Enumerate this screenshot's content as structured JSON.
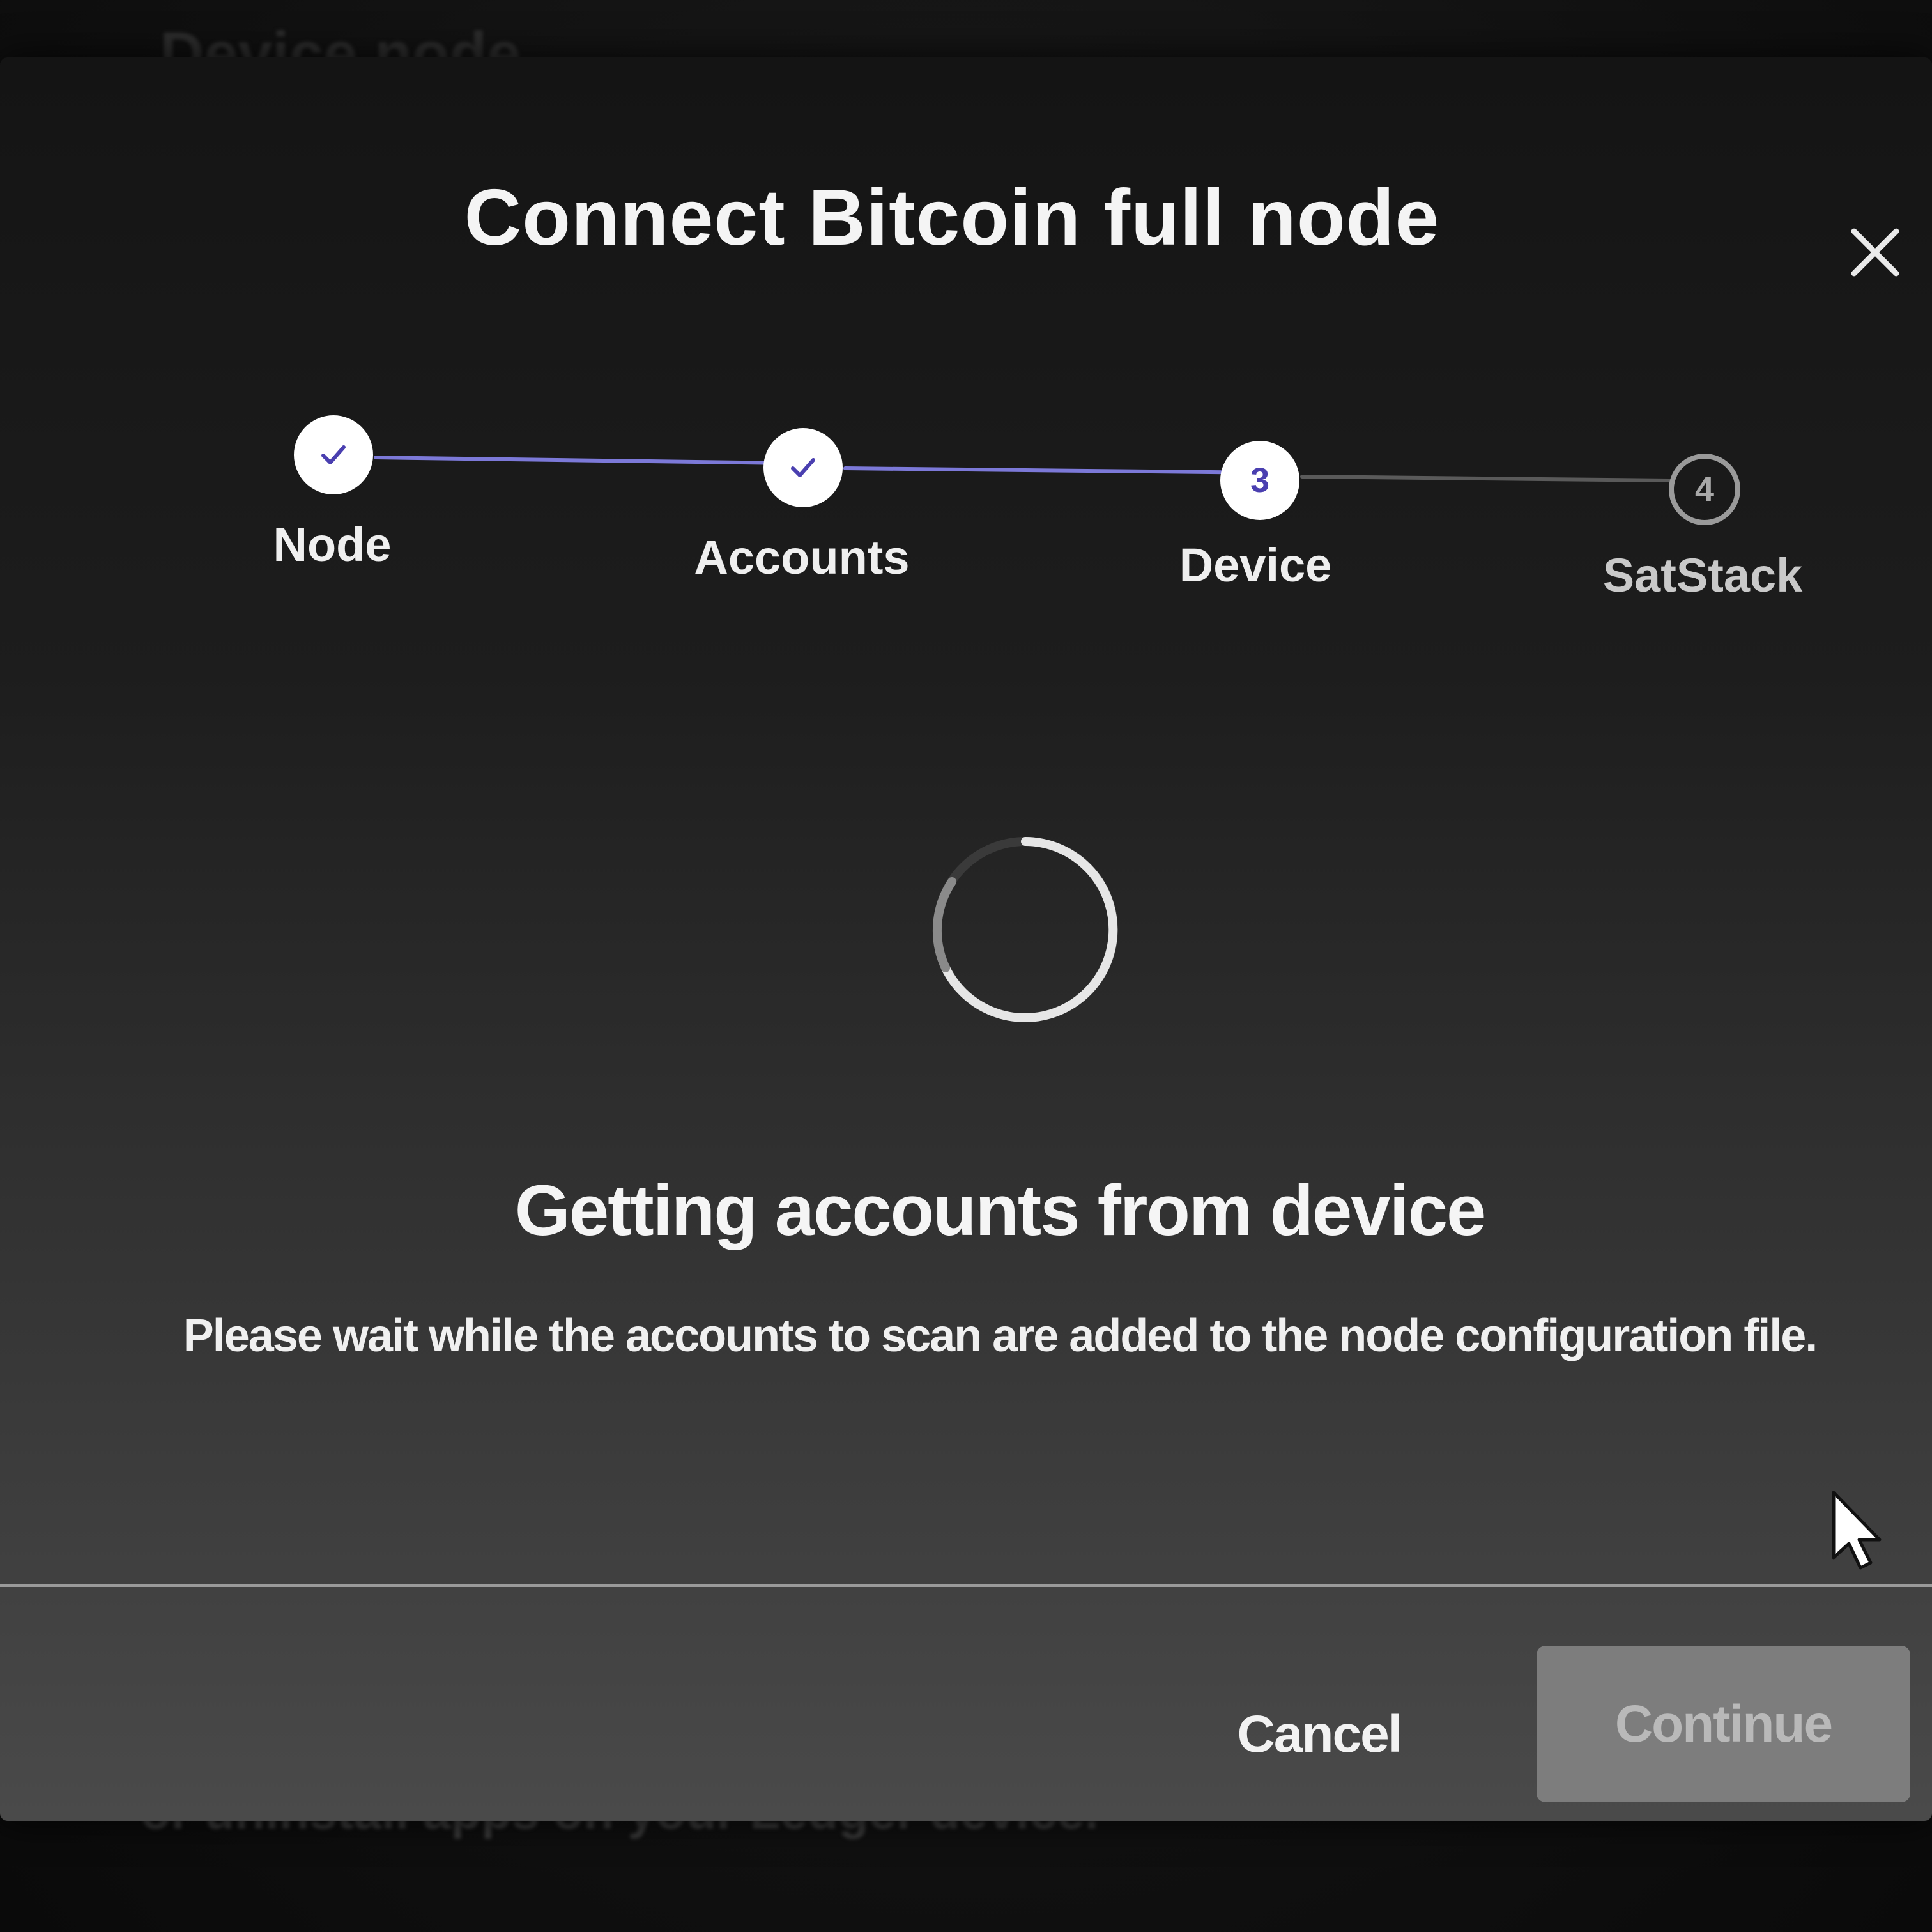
{
  "background": {
    "heading": "Device node",
    "text": "or uninstall apps on your Ledger device."
  },
  "modal": {
    "title": "Connect Bitcoin full node",
    "close_icon": "close-icon"
  },
  "stepper": {
    "steps": [
      {
        "label": "Node",
        "state": "done",
        "marker": "✓"
      },
      {
        "label": "Accounts",
        "state": "done",
        "marker": "✓"
      },
      {
        "label": "Device",
        "state": "active",
        "marker": "3"
      },
      {
        "label": "SatStack",
        "state": "todo",
        "marker": "4"
      }
    ],
    "colors": {
      "done_line": "#7c79d8",
      "todo_line": "#5a5a5a",
      "accent": "#4a3fb0"
    }
  },
  "status": {
    "icon": "spinner-icon",
    "title": "Getting accounts from device",
    "text": "Please wait while the accounts to scan are added to the node configuration file."
  },
  "footer": {
    "cancel_label": "Cancel",
    "continue_label": "Continue"
  }
}
